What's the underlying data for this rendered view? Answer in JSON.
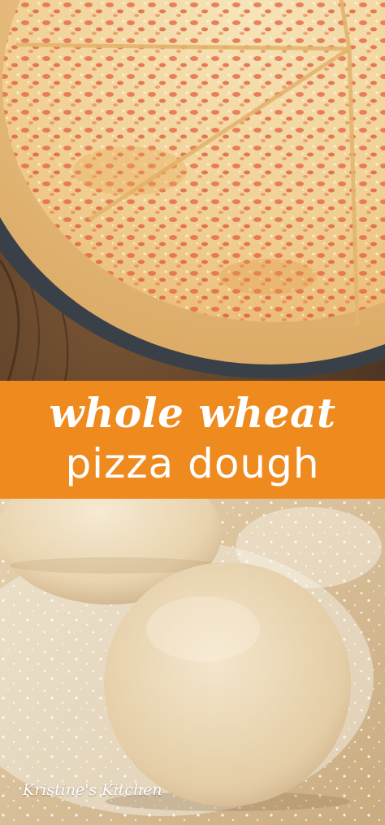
{
  "title": {
    "line1": "whole wheat",
    "line2": "pizza dough"
  },
  "watermark": "Kristine's Kitchen",
  "colors": {
    "banner": "#ef8a1f",
    "title_text": "#ffffff",
    "wood": "#6b4a2e",
    "crust": "#e2b878",
    "cheese": "#f1d6a2",
    "sauce_spot": "#e2553a",
    "pan": "#3a4048",
    "dough": "#ead8b8",
    "flour_board": "#d8c2a0"
  }
}
